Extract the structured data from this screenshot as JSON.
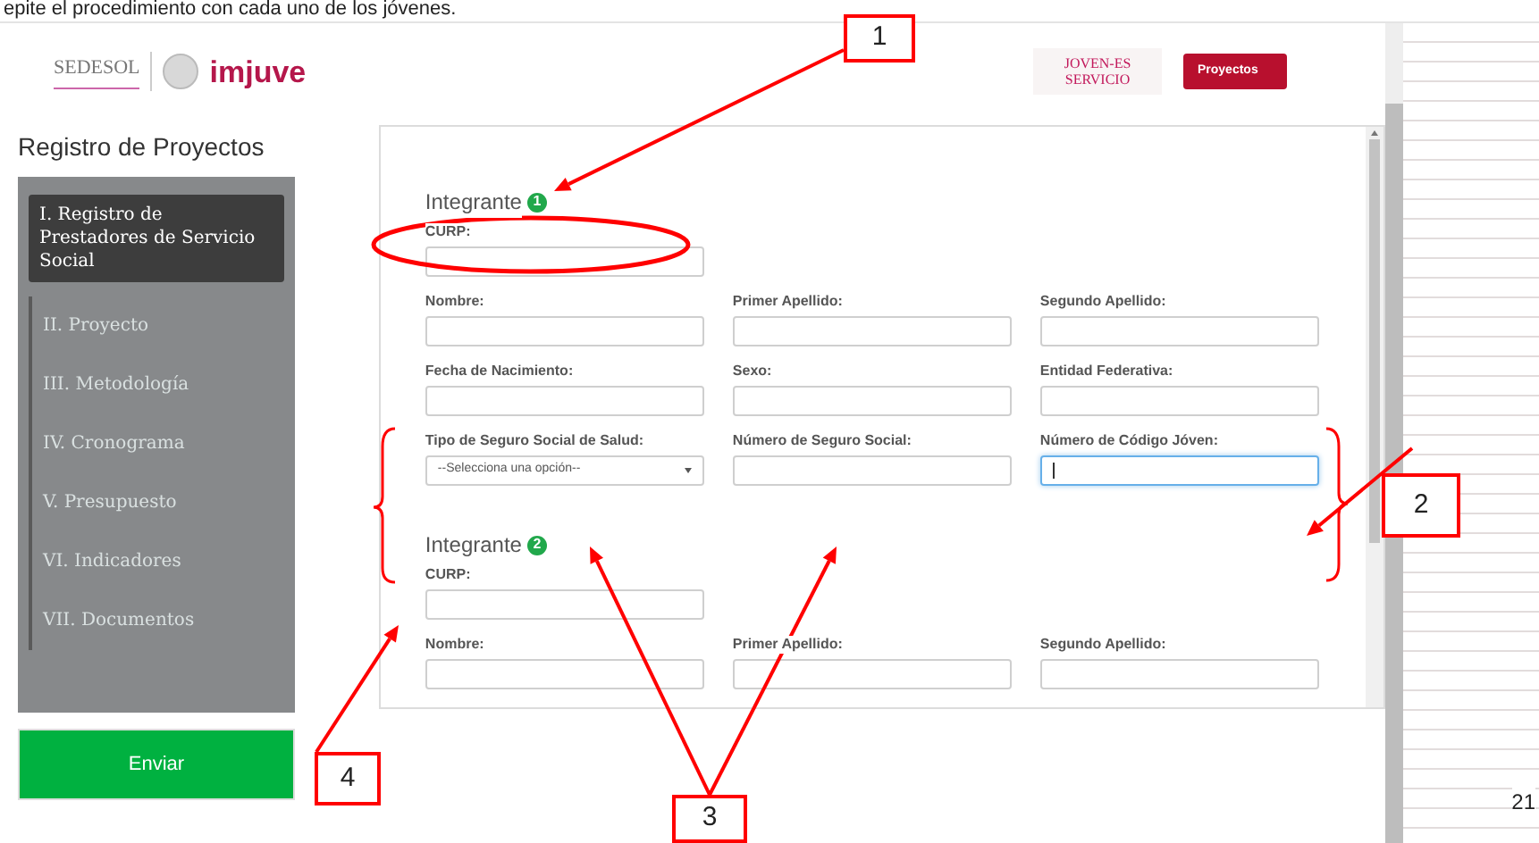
{
  "document": {
    "caption": "epite el procedimiento con cada uno de los jóvenes.",
    "page_number": "21"
  },
  "header": {
    "sedesol_logo": "SEDESOL",
    "imjuve_logo": "imjuve",
    "program_logo_lines": [
      "JOVEN-ES",
      "SERVICIO"
    ],
    "nav_button": "Proyectos"
  },
  "sidebar": {
    "title": "Registro de Proyectos",
    "items": [
      {
        "label": "I. Registro de Prestadores de Servicio Social",
        "selected": true
      },
      {
        "label": "II. Proyecto",
        "selected": false
      },
      {
        "label": "III. Metodología",
        "selected": false
      },
      {
        "label": "IV. Cronograma",
        "selected": false
      },
      {
        "label": "V. Presupuesto",
        "selected": false
      },
      {
        "label": "VI. Indicadores",
        "selected": false
      },
      {
        "label": "VII. Documentos",
        "selected": false
      }
    ],
    "submit_button": "Enviar"
  },
  "form": {
    "members": [
      {
        "heading": "Integrante",
        "number": "1",
        "rows": [
          [
            {
              "label": "CURP:",
              "kind": "text",
              "focused": false
            }
          ],
          [
            {
              "label": "Nombre:",
              "kind": "text",
              "focused": false
            },
            {
              "label": "Primer Apellido:",
              "kind": "text",
              "focused": false
            },
            {
              "label": "Segundo Apellido:",
              "kind": "text",
              "focused": false
            }
          ],
          [
            {
              "label": "Fecha de Nacimiento:",
              "kind": "text",
              "focused": false
            },
            {
              "label": "Sexo:",
              "kind": "text",
              "focused": false
            },
            {
              "label": "Entidad Federativa:",
              "kind": "text",
              "focused": false
            }
          ],
          [
            {
              "label": "Tipo de Seguro Social de Salud:",
              "kind": "select",
              "value": "--Selecciona una opción--",
              "focused": false
            },
            {
              "label": "Número de Seguro Social:",
              "kind": "text",
              "focused": false
            },
            {
              "label": "Número de Código Jóven:",
              "kind": "text",
              "focused": true
            }
          ]
        ]
      },
      {
        "heading": "Integrante",
        "number": "2",
        "rows": [
          [
            {
              "label": "CURP:",
              "kind": "text",
              "focused": false
            }
          ],
          [
            {
              "label": "Nombre:",
              "kind": "text",
              "focused": false
            },
            {
              "label": "Primer Apellido:",
              "kind": "text",
              "focused": false
            },
            {
              "label": "Segundo Apellido:",
              "kind": "text",
              "focused": false
            }
          ]
        ]
      }
    ]
  },
  "annotations": {
    "callouts": [
      {
        "number": "1"
      },
      {
        "number": "2"
      },
      {
        "number": "3"
      },
      {
        "number": "4"
      }
    ]
  }
}
